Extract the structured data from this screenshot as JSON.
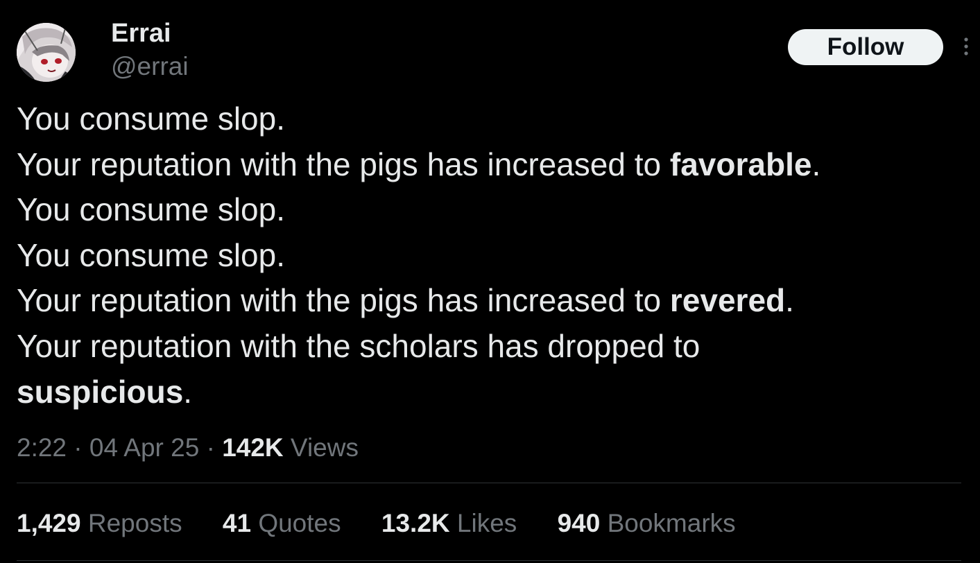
{
  "author": {
    "display_name": "Errai",
    "handle": "@errai",
    "avatar_icon": "anime-avatar"
  },
  "follow_label": "Follow",
  "more_icon": "more-vertical-icon",
  "tweet": {
    "lines": [
      {
        "text": "You consume slop.",
        "bold": "",
        "suffix": ""
      },
      {
        "text": "Your reputation with the pigs has increased to ",
        "bold": "favorable",
        "suffix": "."
      },
      {
        "text": "You consume slop.",
        "bold": "",
        "suffix": ""
      },
      {
        "text": "You consume slop.",
        "bold": "",
        "suffix": ""
      },
      {
        "text": "Your reputation with the pigs has increased to ",
        "bold": "revered",
        "suffix": "."
      },
      {
        "text": "Your reputation with the scholars has dropped to",
        "bold": "",
        "suffix": ""
      },
      {
        "text": "",
        "bold": "suspicious",
        "suffix": "."
      }
    ]
  },
  "meta": {
    "time": "2:22",
    "sep1": " · ",
    "date": "04 Apr 25",
    "sep2": " · ",
    "views_count": "142K",
    "views_label": " Views"
  },
  "stats": {
    "reposts": {
      "count": "1,429",
      "label": " Reposts"
    },
    "quotes": {
      "count": "41",
      "label": " Quotes"
    },
    "likes": {
      "count": "13.2K",
      "label": " Likes"
    },
    "bookmarks": {
      "count": "940",
      "label": " Bookmarks"
    }
  },
  "colors": {
    "background": "#000000",
    "text_primary": "#e7e9ea",
    "text_secondary": "#71767b",
    "divider": "#2f3336",
    "follow_bg": "#eff3f4"
  }
}
